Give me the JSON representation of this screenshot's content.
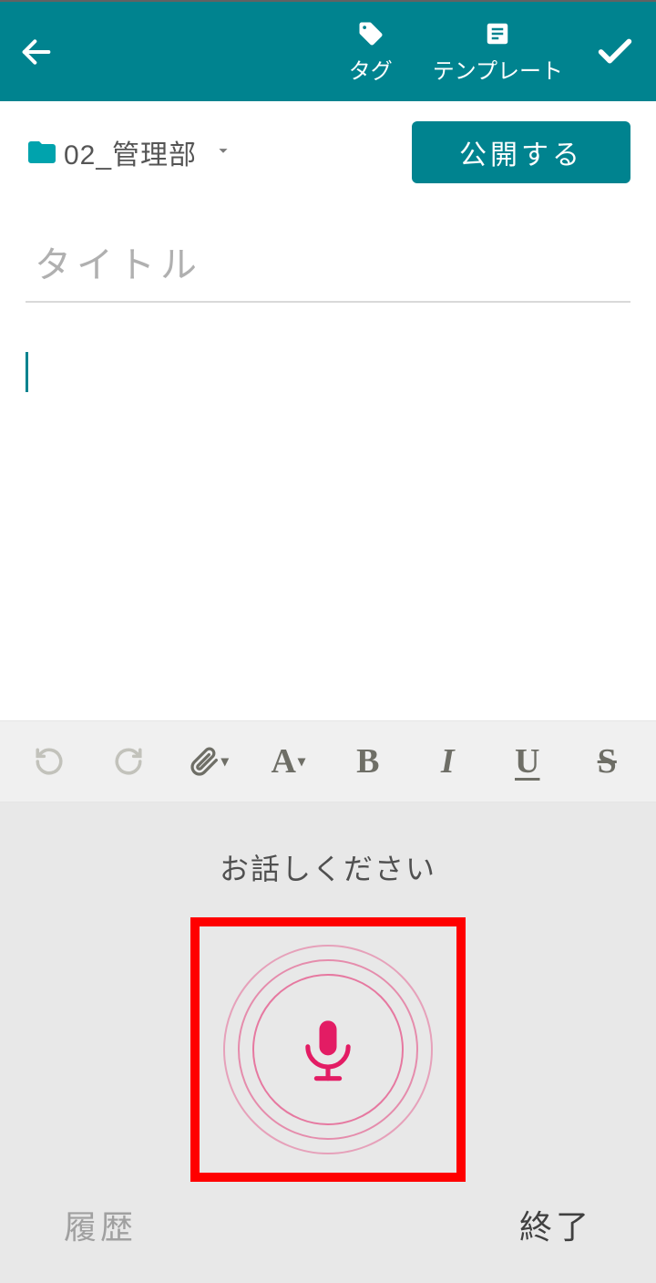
{
  "header": {
    "tag_label": "タグ",
    "template_label": "テンプレート"
  },
  "folder": {
    "name": "02_管理部"
  },
  "actions": {
    "publish": "公開する"
  },
  "editor": {
    "title_placeholder": "タイトル",
    "title_value": "",
    "body_value": ""
  },
  "voice": {
    "prompt": "お話しください",
    "history": "履歴",
    "end": "終了"
  },
  "colors": {
    "primary": "#00838f",
    "accent": "#e31c64"
  }
}
